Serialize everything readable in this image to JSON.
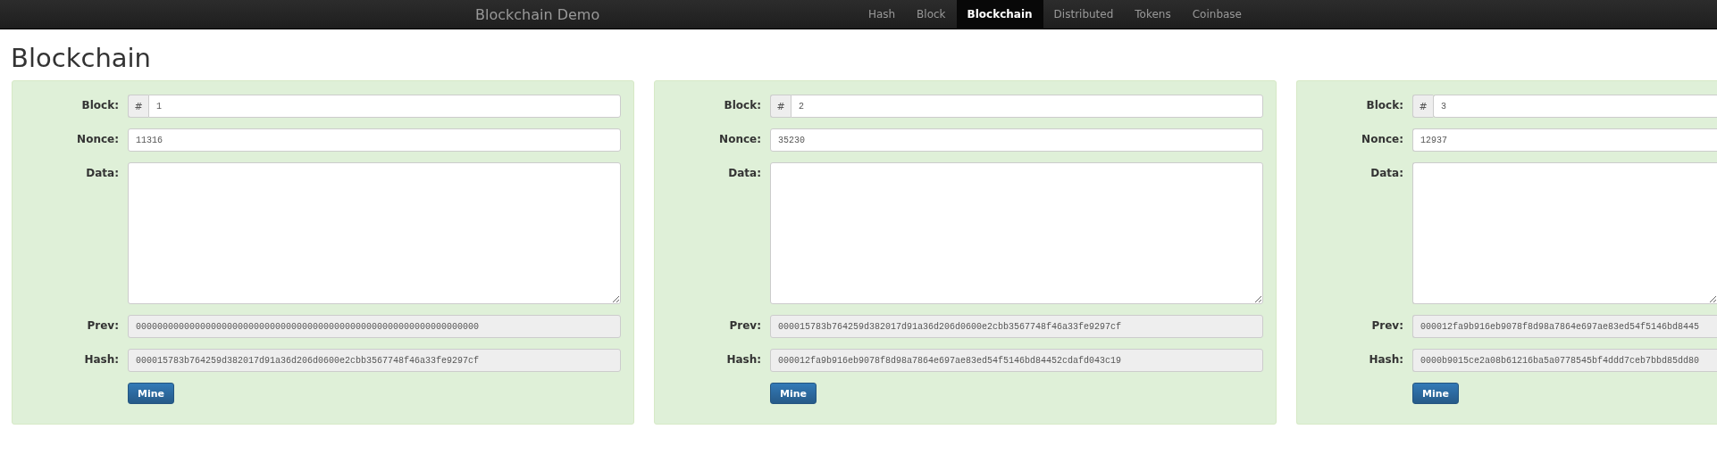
{
  "navbar": {
    "brand": "Blockchain Demo",
    "items": [
      {
        "label": "Hash",
        "selected": false
      },
      {
        "label": "Block",
        "selected": false
      },
      {
        "label": "Blockchain",
        "selected": true
      },
      {
        "label": "Distributed",
        "selected": false
      },
      {
        "label": "Tokens",
        "selected": false
      },
      {
        "label": "Coinbase",
        "selected": false
      }
    ]
  },
  "title": "Blockchain",
  "blocks": [
    {
      "valid": true,
      "block_label": "Block:",
      "prefix": "#",
      "number": "1",
      "nonce_label": "Nonce:",
      "nonce": "11316",
      "data_label": "Data:",
      "prev_label": "Prev:",
      "prev": "0000000000000000000000000000000000000000000000000000000000000000",
      "hash_label": "Hash:",
      "hash": "000015783b764259d382017d91a36d206d0600e2cbb3567748f46a33fe9297cf",
      "button": "Mine"
    },
    {
      "valid": true,
      "block_label": "Block:",
      "prefix": "#",
      "number": "2",
      "nonce_label": "Nonce:",
      "nonce": "35230",
      "data_label": "Data:",
      "prev_label": "Prev:",
      "prev": "000015783b764259d382017d91a36d206d0600e2cbb3567748f46a33fe9297cf",
      "hash_label": "Hash:",
      "hash": "000012fa9b916eb9078f8d98a7864e697ae83ed54f5146bd84452cdafd043c19",
      "button": "Mine"
    },
    {
      "valid": true,
      "block_label": "Block:",
      "prefix": "#",
      "number": "3",
      "nonce_label": "Nonce:",
      "nonce": "12937",
      "data_label": "Data:",
      "prev_label": "Prev:",
      "prev": "000012fa9b916eb9078f8d98a7864e697ae83ed54f5146bd8445",
      "hash_label": "Hash:",
      "hash": "0000b9015ce2a08b61216ba5a0778545bf4ddd7ceb7bbd85dd80",
      "button": "Mine"
    }
  ]
}
